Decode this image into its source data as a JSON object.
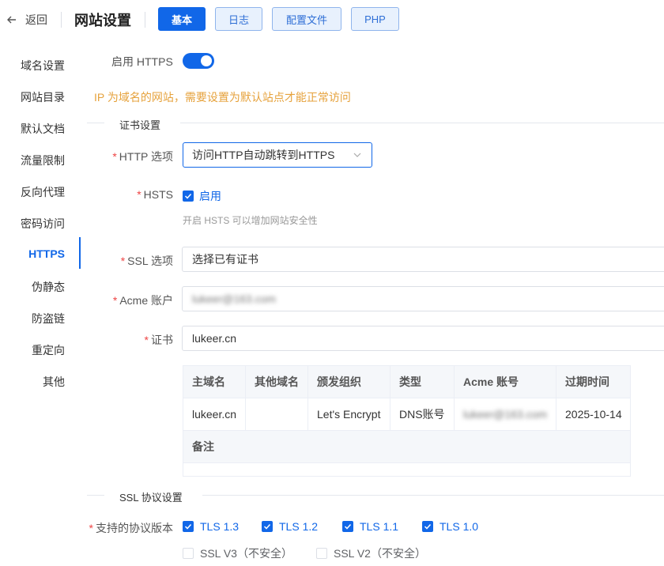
{
  "header": {
    "back_label": "返回",
    "title": "网站设置",
    "tabs": [
      {
        "label": "基本",
        "active": true
      },
      {
        "label": "日志",
        "active": false
      },
      {
        "label": "配置文件",
        "active": false
      },
      {
        "label": "PHP",
        "active": false
      }
    ]
  },
  "sidebar": {
    "items": [
      {
        "label": "域名设置",
        "active": false
      },
      {
        "label": "网站目录",
        "active": false
      },
      {
        "label": "默认文档",
        "active": false
      },
      {
        "label": "流量限制",
        "active": false
      },
      {
        "label": "反向代理",
        "active": false
      },
      {
        "label": "密码访问",
        "active": false
      },
      {
        "label": "HTTPS",
        "active": true
      },
      {
        "label": "伪静态",
        "active": false
      },
      {
        "label": "防盗链",
        "active": false
      },
      {
        "label": "重定向",
        "active": false
      },
      {
        "label": "其他",
        "active": false
      }
    ]
  },
  "form": {
    "https_label": "启用 HTTPS",
    "https_enabled": true,
    "notice": "IP 为域名的网站，需要设置为默认站点才能正常访问",
    "cert_section": "证书设置",
    "http_option_label": "HTTP 选项",
    "http_option_value": "访问HTTP自动跳转到HTTPS",
    "hsts_label": "HSTS",
    "hsts_check_label": "启用",
    "hsts_checked": true,
    "hsts_hint": "开启 HSTS 可以增加网站安全性",
    "ssl_option_label": "SSL 选项",
    "ssl_option_value": "选择已有证书",
    "acme_label": "Acme 账户",
    "acme_value": "lukeer@163.com",
    "cert_label": "证书",
    "cert_value": "lukeer.cn",
    "required_mark": "*"
  },
  "cert_table": {
    "headers": [
      "主域名",
      "其他域名",
      "颁发组织",
      "类型",
      "Acme 账号",
      "过期时间"
    ],
    "row": [
      "lukeer.cn",
      "",
      "Let's Encrypt",
      "DNS账号",
      "lukeer@163.com",
      "2025-10-14"
    ],
    "note_label": "备注"
  },
  "ssl_protocol": {
    "section": "SSL 协议设置",
    "label": "支持的协议版本",
    "options": [
      {
        "label": "TLS 1.3",
        "checked": true
      },
      {
        "label": "TLS 1.2",
        "checked": true
      },
      {
        "label": "TLS 1.1",
        "checked": true
      },
      {
        "label": "TLS 1.0",
        "checked": true
      },
      {
        "label": "SSL V3（不安全）",
        "checked": false
      },
      {
        "label": "SSL V2（不安全）",
        "checked": false
      }
    ]
  },
  "colors": {
    "accent": "#1167e8",
    "warning": "#e6a23c",
    "required": "#ee4444"
  }
}
